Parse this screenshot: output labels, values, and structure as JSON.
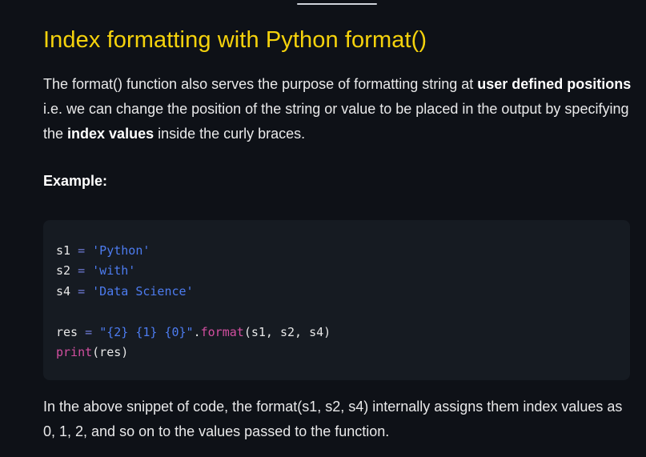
{
  "heading": "Index formatting with Python format()",
  "intro": {
    "t1": "The format() function also serves the purpose of formatting string at ",
    "b1": "user defined positions",
    "t2": " i.e. we can change the position of the string or value to be placed in the output by specifying the ",
    "b2": "index values",
    "t3": " inside the curly braces."
  },
  "example_label": "Example:",
  "code": {
    "line1": {
      "var": "s1",
      "op": "=",
      "str": "'Python'"
    },
    "line2": {
      "var": "s2",
      "op": "=",
      "str": "'with'"
    },
    "line3": {
      "var": "s4",
      "op": "=",
      "str": "'Data Science'"
    },
    "line4": {
      "var": "res",
      "op": "=",
      "str": "\"{2} {1} {0}\"",
      "dot": ".",
      "fn": "format",
      "args": "(s1, s2, s4)"
    },
    "line5": {
      "fn": "print",
      "args": "(res)"
    }
  },
  "outro": "In the above snippet of code, the format(s1, s2, s4) internally assigns them index values as 0, 1, 2, and so on to the values passed to the function.",
  "colors": {
    "background": "#0e1117",
    "heading": "#f5d20c",
    "code_bg": "#161b22",
    "string": "#4d7cf0",
    "function": "#d24fa0"
  }
}
